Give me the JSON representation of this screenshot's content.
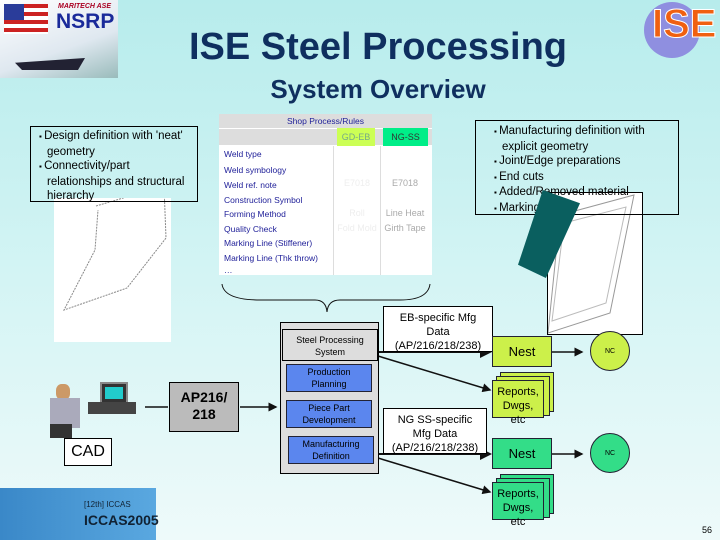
{
  "header": {
    "title": "ISE Steel Processing",
    "subtitle": "System Overview",
    "left_logo": "NSRP",
    "left_logo_sub": "MARITECH ASE",
    "right_logo": "ISE"
  },
  "design_box": {
    "bullets": [
      "Design definition with 'neat' geometry",
      "Connectivity/part relationships and structural hierarchy"
    ]
  },
  "mfg_box": {
    "bullets": [
      "Manufacturing definition with explicit geometry",
      "Joint/Edge preparations",
      "End cuts",
      "Added/Removed material",
      "Marking lines"
    ]
  },
  "table": {
    "title": "Shop Process/Rules",
    "col_eb": "GD-EB",
    "col_ss": "NG-SS",
    "rows": [
      "Weld type",
      "Weld symbology",
      "Weld ref. note",
      "Construction Symbol",
      "Forming Method",
      "Quality Check",
      "Marking Line (Stiffener)",
      "Marking Line (Thk throw)",
      "…"
    ],
    "eb_values": [
      "",
      "",
      "E7018",
      "",
      "Roll",
      "Fold Mold",
      "",
      "",
      ""
    ],
    "ss_values": [
      "",
      "",
      "E7018",
      "",
      "Line Heat",
      "Girth Tape",
      "",
      "",
      ""
    ],
    "colors": {
      "eb": "#ccff55",
      "ss": "#00ee88"
    }
  },
  "flow": {
    "cad": "CAD",
    "ap": "AP216/ 218",
    "sps": "Steel Processing System",
    "modules": [
      "Production Planning",
      "Piece Part Development",
      "Manufacturing Definition"
    ],
    "eb_data": "EB-specific Mfg Data (AP/216/218/238)",
    "ng_data": "NG SS-specific Mfg Data (AP/216/218/238)",
    "nest": "Nest",
    "nc": "NC",
    "reports": "Reports, Dwgs, etc",
    "colors": {
      "eb": "#ccf04a",
      "ng": "#33dd88",
      "module": "#5b86ee"
    }
  },
  "footer": {
    "banner": "ICCAS2005",
    "banner_sub": "[12th] ICCAS",
    "page": "56"
  }
}
